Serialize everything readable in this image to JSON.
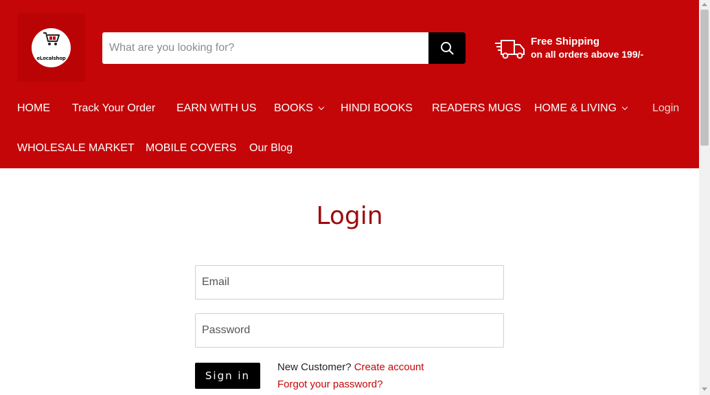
{
  "header": {
    "logo_text": "eLocalshop",
    "search": {
      "placeholder": "What are you looking for?"
    },
    "shipping": {
      "title": "Free Shipping",
      "subtitle": "on all orders above 199/-"
    }
  },
  "nav": {
    "home": "HOME",
    "track": "Track Your Order",
    "earn": "EARN WITH US",
    "books": "BOOKS",
    "hindi": "HINDI BOOKS",
    "mugs": "READERS MUGS",
    "living": "HOME & LIVING",
    "login": "Login",
    "wholesale": "WHOLESALE MARKET",
    "covers": "MOBILE COVERS",
    "blog": "Our Blog"
  },
  "login": {
    "title": "Login",
    "email_placeholder": "Email",
    "password_placeholder": "Password",
    "signin_label": "Sign in",
    "new_customer": "New Customer?",
    "create_account": "Create account",
    "forgot_password": "Forgot your password?"
  },
  "colors": {
    "brand_red": "#c40608",
    "title_red": "#9c0b0d",
    "link_red": "#c40608"
  },
  "icons": {
    "search": "search-icon",
    "truck": "truck-icon",
    "cart": "cart-icon",
    "chevron": "chevron-down-icon"
  }
}
